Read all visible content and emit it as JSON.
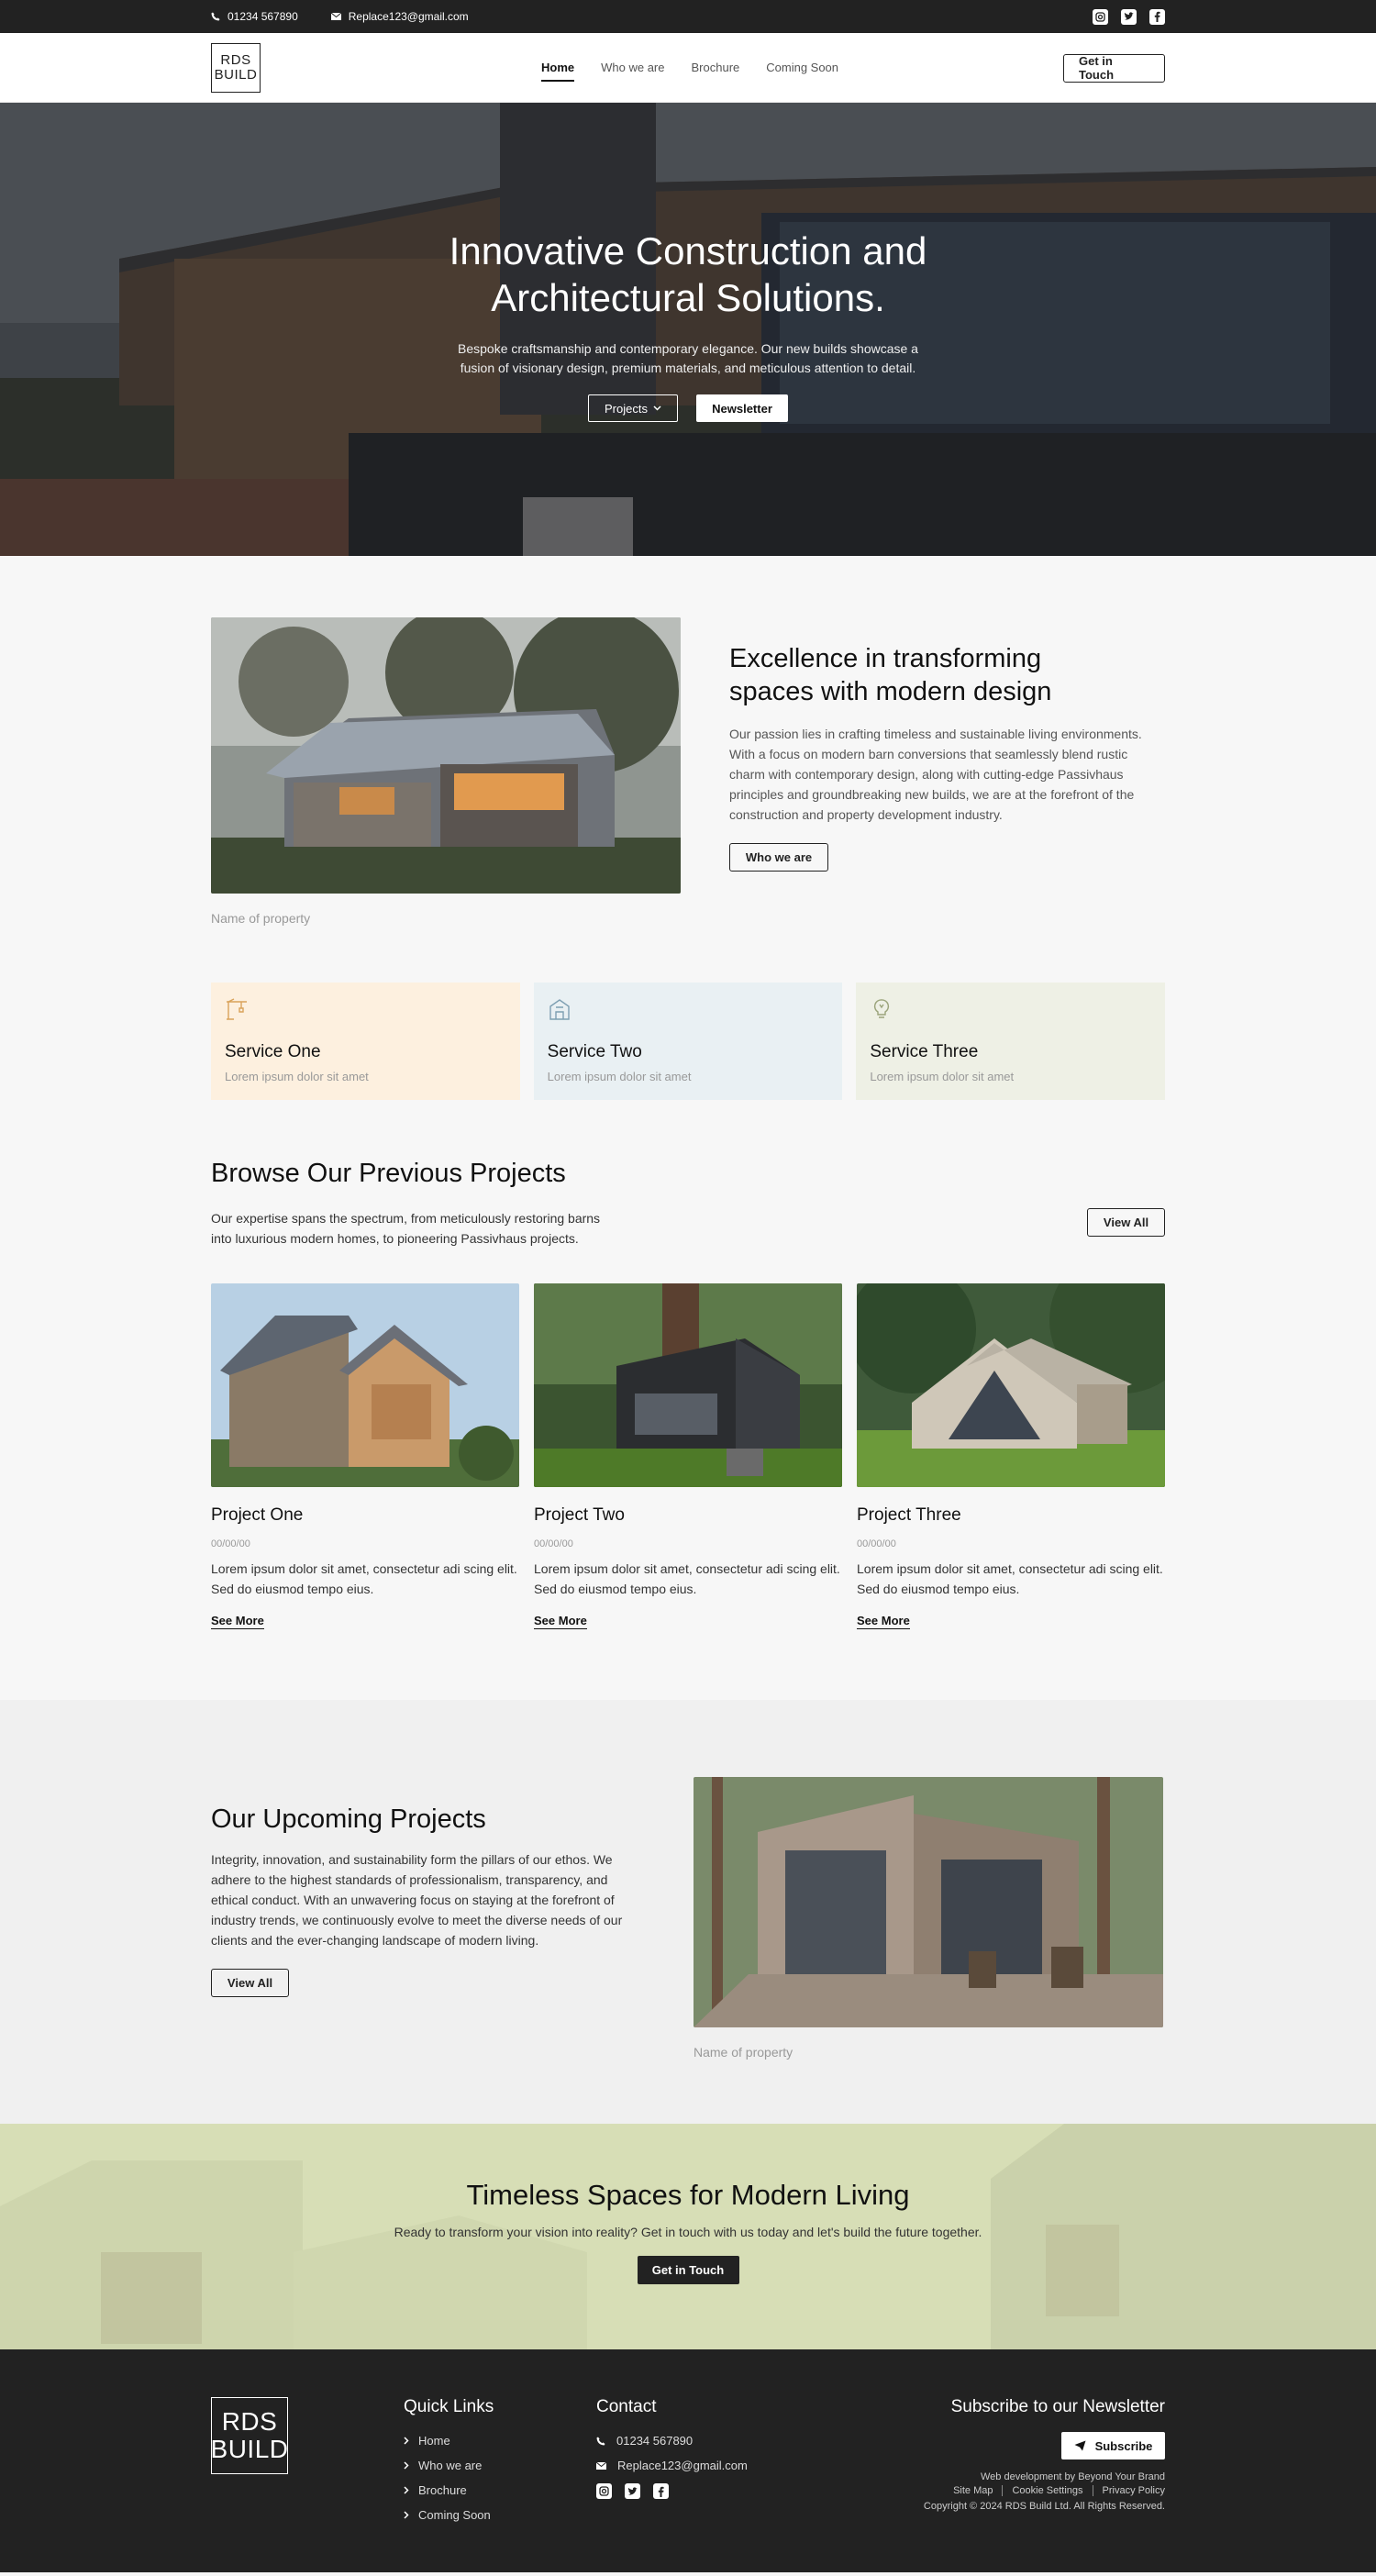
{
  "topbar": {
    "phone": "01234 567890",
    "email": "Replace123@gmail.com",
    "social": [
      "instagram-icon",
      "twitter-icon",
      "facebook-icon"
    ]
  },
  "nav": {
    "logo_line1": "RDS",
    "logo_line2": "BUILD",
    "items": [
      {
        "label": "Home",
        "active": true
      },
      {
        "label": "Who we are",
        "active": false
      },
      {
        "label": "Brochure",
        "active": false
      },
      {
        "label": "Coming Soon",
        "active": false
      }
    ],
    "cta": "Get in Touch"
  },
  "hero": {
    "title_line1": "Innovative Construction and",
    "title_line2": "Architectural Solutions.",
    "subtitle_line1": "Bespoke craftsmanship and contemporary elegance. Our new builds showcase a",
    "subtitle_line2": "fusion of visionary design, premium materials, and meticulous attention to detail.",
    "btn_projects": "Projects",
    "btn_newsletter": "Newsletter"
  },
  "excellence": {
    "title_line1": "Excellence in transforming",
    "title_line2": "spaces with modern design",
    "body": "Our passion lies in crafting timeless and sustainable living environments. With a focus on modern barn conversions that seamlessly blend rustic charm with contemporary design, along with cutting-edge Passivhaus principles and groundbreaking new builds, we are at the forefront of the construction and property development industry.",
    "button": "Who we are",
    "caption": "Name of property"
  },
  "services": [
    {
      "title": "Service One",
      "text": "Lorem ipsum dolor sit amet",
      "bg": "#fdf0df",
      "icon": "crane-icon",
      "color": "#d9a25a"
    },
    {
      "title": "Service Two",
      "text": "Lorem ipsum dolor sit amet",
      "bg": "#e9f0f3",
      "icon": "building-icon",
      "color": "#7e9fb2"
    },
    {
      "title": "Service Three",
      "text": "Lorem ipsum dolor sit amet",
      "bg": "#eef0e5",
      "icon": "lightbulb-icon",
      "color": "#9aa37a"
    }
  ],
  "projects": {
    "title": "Browse Our Previous Projects",
    "intro_line1": "Our expertise spans the spectrum, from meticulously restoring barns",
    "intro_line2": "into luxurious modern homes, to pioneering Passivhaus projects.",
    "view_all": "View All",
    "items": [
      {
        "title": "Project One",
        "date": "00/00/00",
        "text": "Lorem ipsum dolor sit amet, consectetur adi scing elit. Sed do eiusmod tempo eius.",
        "link": "See More"
      },
      {
        "title": "Project Two",
        "date": "00/00/00",
        "text": "Lorem ipsum dolor sit amet, consectetur adi scing elit. Sed do eiusmod tempo eius.",
        "link": "See More"
      },
      {
        "title": "Project Three",
        "date": "00/00/00",
        "text": "Lorem ipsum dolor sit amet, consectetur adi scing elit. Sed do eiusmod tempo eius.",
        "link": "See More"
      }
    ]
  },
  "upcoming": {
    "title": "Our Upcoming Projects",
    "body": "Integrity, innovation, and sustainability form the pillars of our ethos. We adhere to the highest standards of professionalism, transparency, and ethical conduct. With an unwavering focus on staying at the forefront of industry trends, we continuously evolve to meet the diverse needs of our clients and the ever-changing landscape of modern living.",
    "button": "View All",
    "caption": "Name of property"
  },
  "cta": {
    "title": "Timeless Spaces for Modern Living",
    "text": "Ready to transform your vision into reality? Get in touch with us today and let's build the future together.",
    "button": "Get in Touch"
  },
  "footer": {
    "logo_line1": "RDS",
    "logo_line2": "BUILD",
    "quick_links_title": "Quick Links",
    "quick_links": [
      "Home",
      "Who we are",
      "Brochure",
      "Coming Soon"
    ],
    "contact_title": "Contact",
    "phone": "01234 567890",
    "email": "Replace123@gmail.com",
    "newsletter_title": "Subscribe to our Newsletter",
    "subscribe": "Subscribe",
    "credit": "Web development by Beyond Your Brand",
    "links": [
      "Site Map",
      "Cookie Settings",
      "Privacy Policy"
    ],
    "copyright": "Copyright © 2024 RDS Build Ltd. All Rights Reserved."
  }
}
